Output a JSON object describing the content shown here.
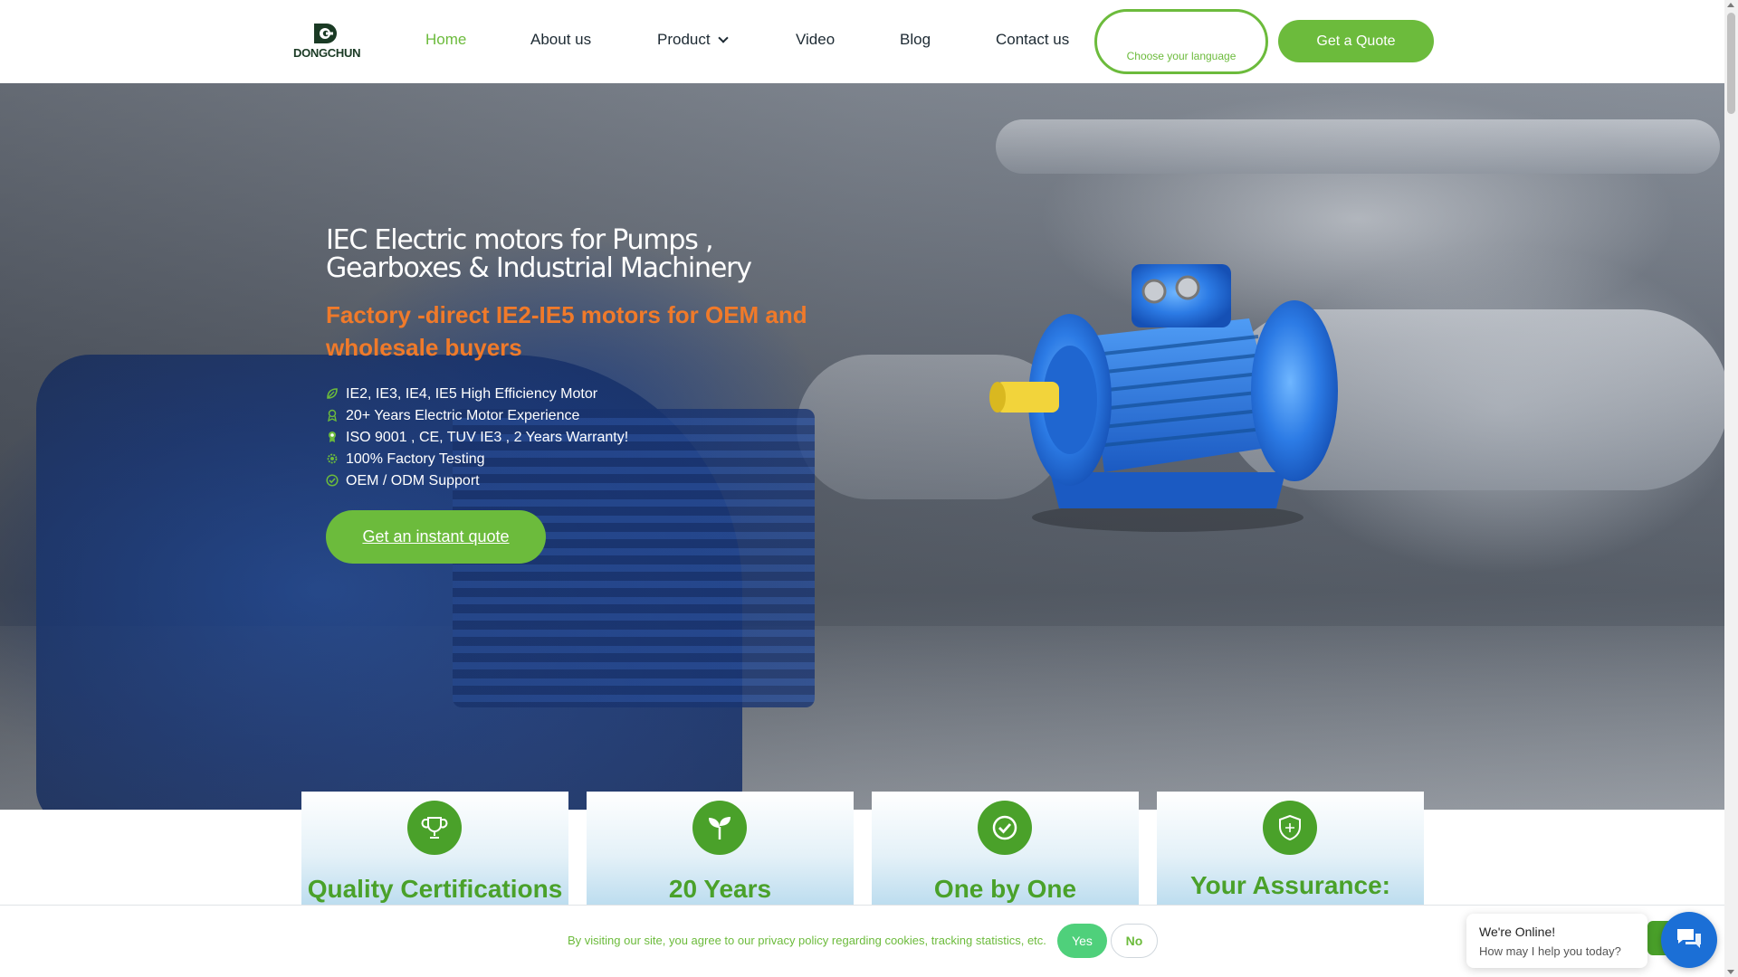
{
  "brand": {
    "name": "DONGCHUN"
  },
  "nav": {
    "items": [
      {
        "label": "Home",
        "active": true
      },
      {
        "label": "About us"
      },
      {
        "label": "Product",
        "has_dropdown": true
      },
      {
        "label": "Video"
      },
      {
        "label": "Blog"
      },
      {
        "label": "Contact us"
      }
    ],
    "language_label": "Choose your language",
    "quote_label": "Get a Quote"
  },
  "hero": {
    "title": "IEC Electric motors for Pumps , Gearboxes & Industrial Machinery",
    "subtitle": "Factory -direct IE2-IE5 motors for OEM and wholesale buyers",
    "features": [
      {
        "icon": "leaf-icon",
        "text": "IE2, IE3, IE4, IE5 High Efficiency Motor"
      },
      {
        "icon": "badge-icon",
        "text": "20+ Years Electric Motor Experience"
      },
      {
        "icon": "award-icon",
        "text": "ISO 9001 , CE, TUV IE3 , 2 Years Warranty!"
      },
      {
        "icon": "gear-icon",
        "text": "100% Factory Testing"
      },
      {
        "icon": "check-circle-icon",
        "text": "OEM / ODM Support"
      }
    ],
    "cta_label": "Get an instant quote"
  },
  "cards": [
    {
      "icon": "trophy-icon",
      "title": "Quality Certifications"
    },
    {
      "icon": "sprout-icon",
      "title": "20 Years"
    },
    {
      "icon": "check-icon",
      "title": "One by One"
    },
    {
      "icon": "shield-icon",
      "title": "Your Assurance:"
    }
  ],
  "cookie": {
    "text": "By visiting our site, you agree to our privacy policy regarding cookies, tracking statistics, etc.",
    "yes_label": "Yes",
    "no_label": "No"
  },
  "chat": {
    "title": "We're Online!",
    "subtitle": "How may I help you today?"
  },
  "colors": {
    "accent": "#6cbb3c",
    "accent_dark": "#4aa12a",
    "orange": "#f07a2a",
    "chat_blue": "#1b6fd6"
  }
}
